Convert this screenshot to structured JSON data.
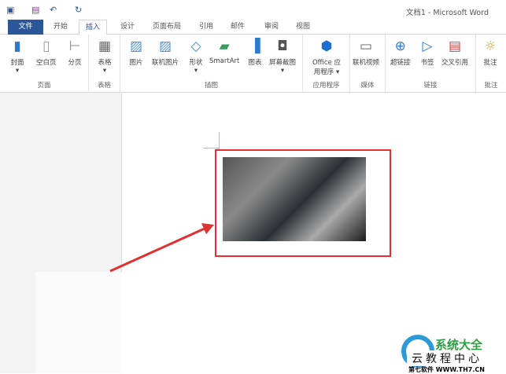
{
  "title": "文档1 - Microsoft Word",
  "quick_access": {
    "word_icon": "word-logo-icon",
    "save_icon": "save-icon",
    "undo": "↶",
    "redo": "↻"
  },
  "tabs": [
    "文件",
    "开始",
    "插入",
    "设计",
    "页面布局",
    "引用",
    "邮件",
    "审阅",
    "视图"
  ],
  "active_tab": "插入",
  "groups": [
    {
      "label": "页面",
      "buttons": [
        "封面",
        "空白页",
        "分页"
      ]
    },
    {
      "label": "表格",
      "buttons": [
        "表格"
      ]
    },
    {
      "label": "插图",
      "buttons": [
        "图片",
        "联机图片",
        "形状",
        "SmartArt",
        "图表",
        "屏幕截图"
      ]
    },
    {
      "label": "应用程序",
      "buttons": [
        "Office 应用程序"
      ]
    },
    {
      "label": "媒体",
      "buttons": [
        "联机视频"
      ]
    },
    {
      "label": "链接",
      "buttons": [
        "超链接",
        "书签",
        "交叉引用"
      ]
    },
    {
      "label": "批注",
      "buttons": [
        "批注"
      ]
    }
  ],
  "watermark": {
    "brand": "系统大全",
    "sub": "云教程中心",
    "url": "第七软件 WWW.TH7.CN"
  },
  "colors": {
    "accent": "#2b579a",
    "highlight": "#e03030"
  }
}
